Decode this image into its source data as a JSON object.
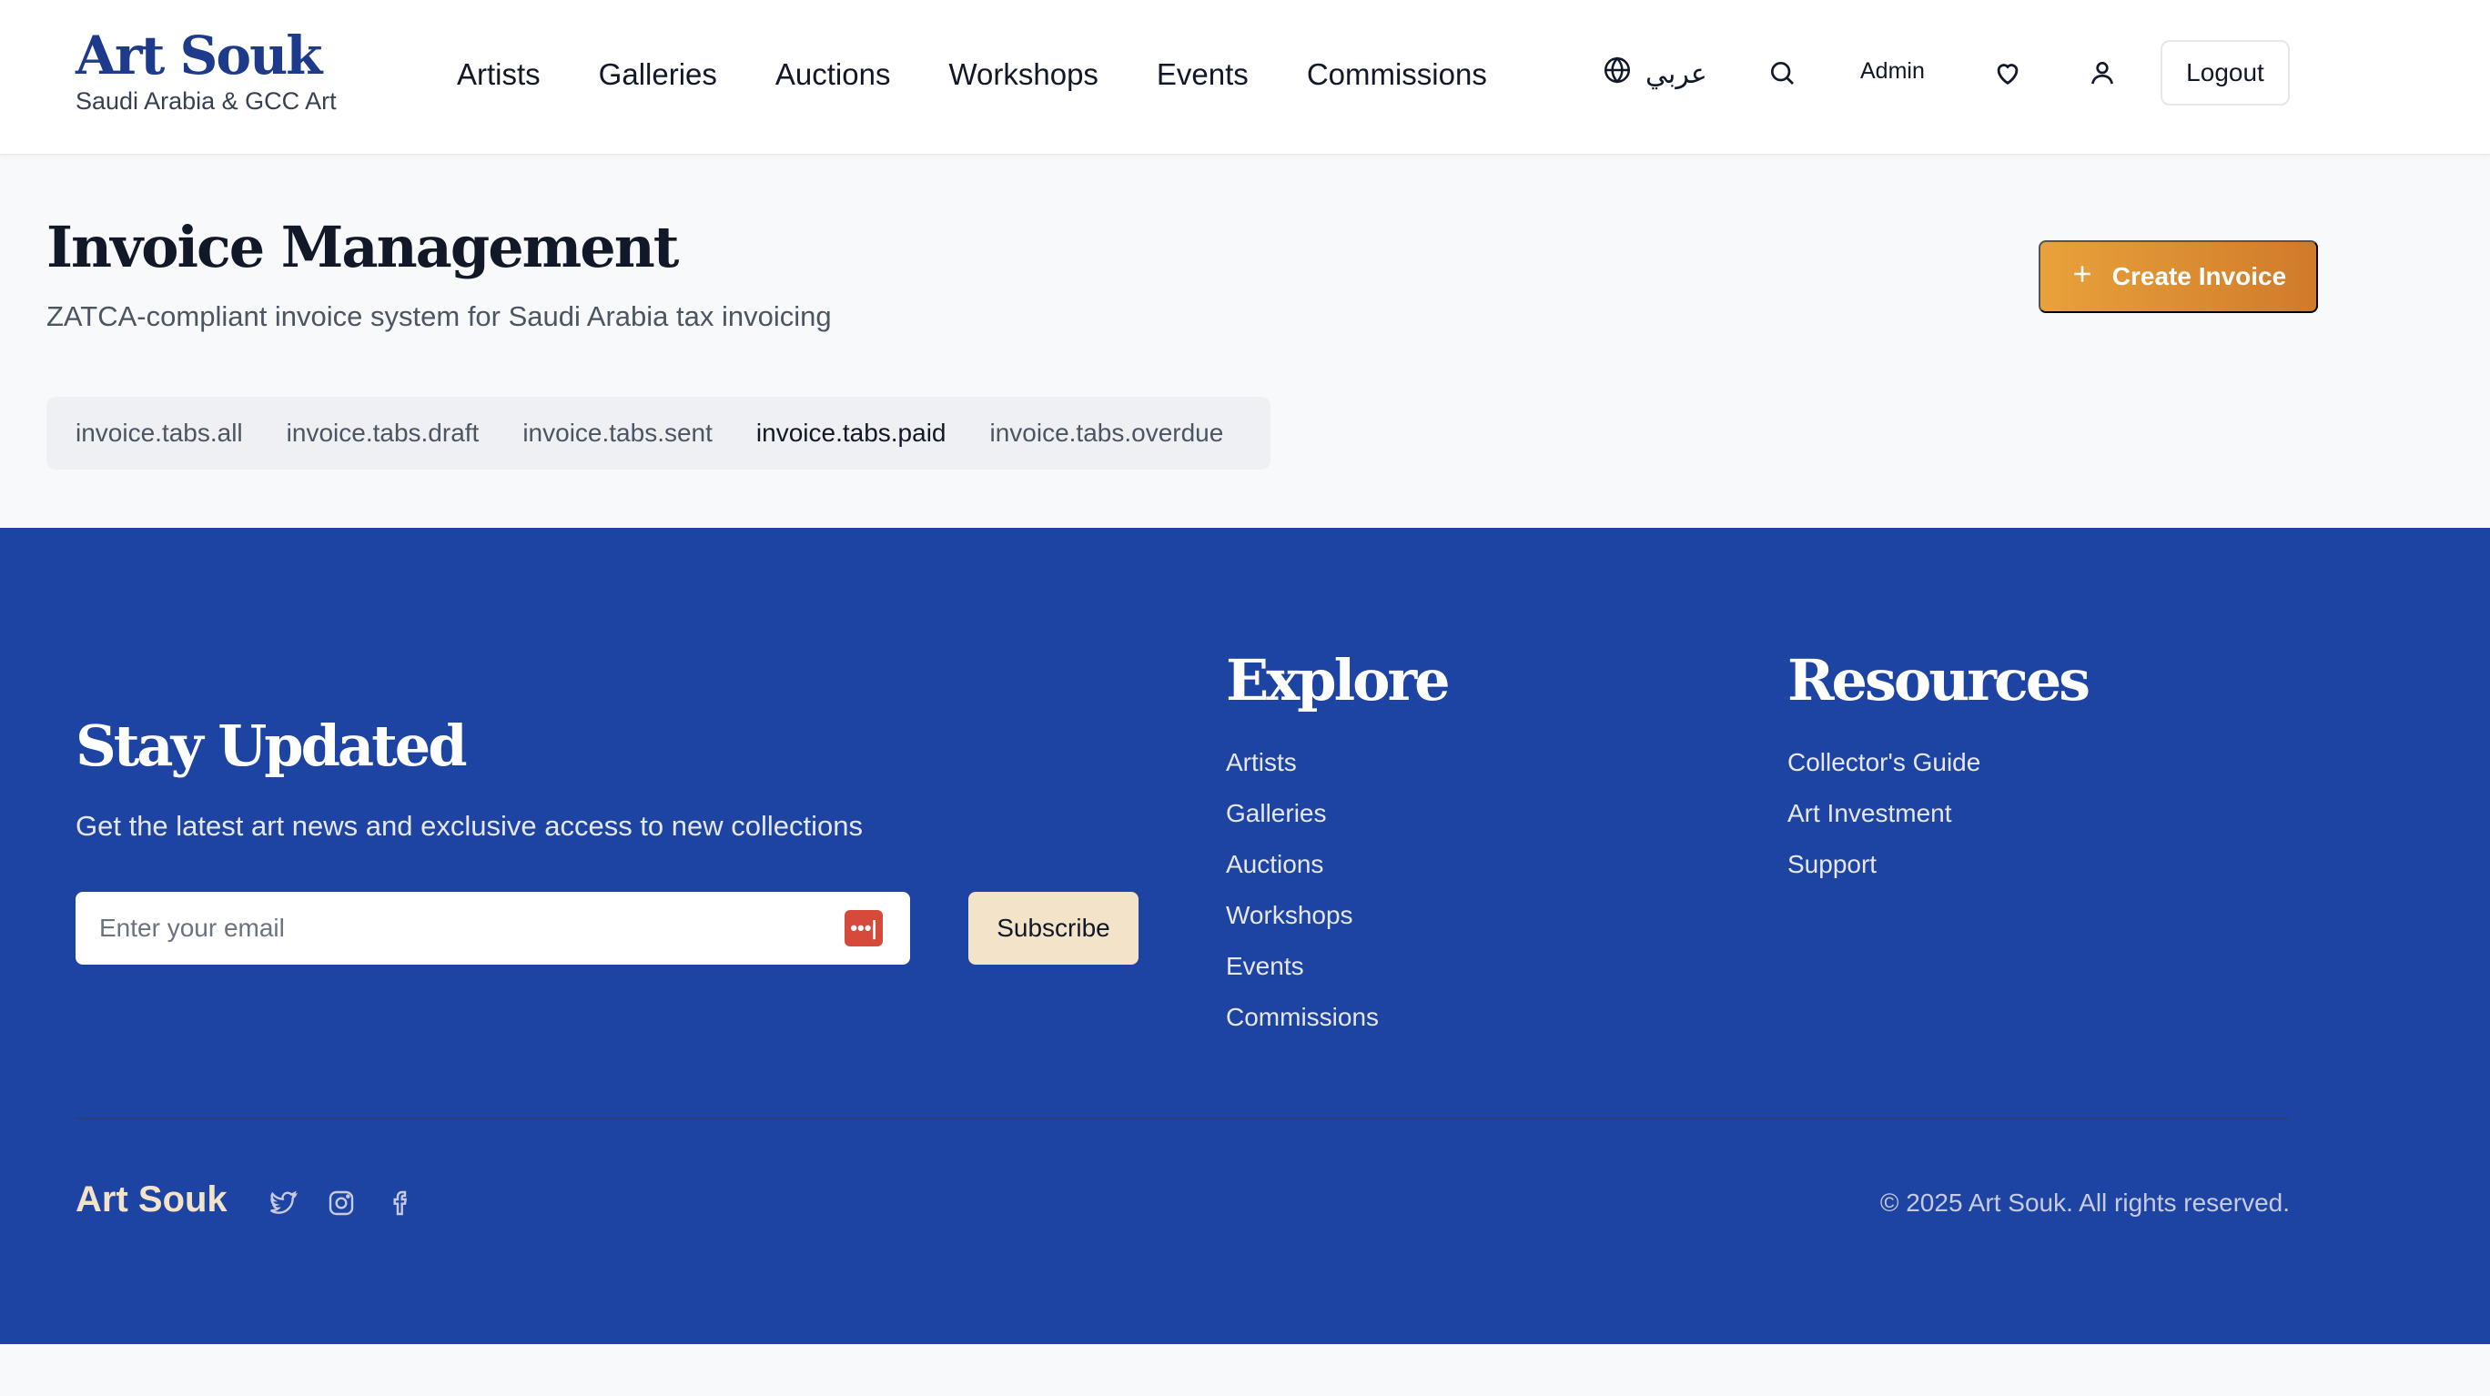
{
  "brand": {
    "title": "Art Souk",
    "subtitle": "Saudi Arabia & GCC Art"
  },
  "nav": {
    "items": [
      "Artists",
      "Galleries",
      "Auctions",
      "Workshops",
      "Events",
      "Commissions"
    ]
  },
  "header": {
    "language_label": "عربي",
    "admin_label": "Admin",
    "logout_label": "Logout",
    "icons": [
      "globe-icon",
      "search-icon",
      "heart-icon",
      "user-icon"
    ]
  },
  "main": {
    "title": "Invoice Management",
    "subtitle": "ZATCA-compliant invoice system for Saudi Arabia tax invoicing",
    "create_button": "Create Invoice",
    "tabs": [
      {
        "label": "invoice.tabs.all",
        "active": false
      },
      {
        "label": "invoice.tabs.draft",
        "active": false
      },
      {
        "label": "invoice.tabs.sent",
        "active": false
      },
      {
        "label": "invoice.tabs.paid",
        "active": true
      },
      {
        "label": "invoice.tabs.overdue",
        "active": false
      }
    ]
  },
  "footer": {
    "newsletter": {
      "title": "Stay Updated",
      "subtitle": "Get the latest art news and exclusive access to new collections",
      "email_placeholder": "Enter your email",
      "subscribe_label": "Subscribe"
    },
    "explore": {
      "title": "Explore",
      "links": [
        "Artists",
        "Galleries",
        "Auctions",
        "Workshops",
        "Events",
        "Commissions"
      ]
    },
    "resources": {
      "title": "Resources",
      "links": [
        "Collector's Guide",
        "Art Investment",
        "Support"
      ]
    },
    "brand": "Art Souk",
    "social_icons": [
      "twitter-icon",
      "instagram-icon",
      "facebook-icon"
    ],
    "copyright": "© 2025 Art Souk. All rights reserved."
  },
  "colors": {
    "brand_blue": "#1e3a8a",
    "footer_bg": "#1e44a3",
    "accent_orange": "#e9a23b",
    "cream": "#f3e3c9"
  }
}
